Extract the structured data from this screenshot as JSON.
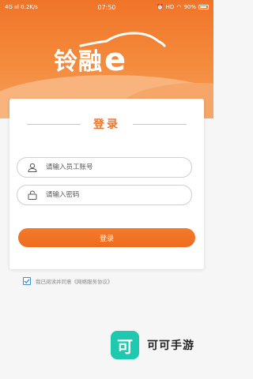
{
  "status_bar": {
    "left": "4G ııl 0.2K/s",
    "time": "07:50",
    "right_text": "HD",
    "battery": "90%"
  },
  "logo": {
    "text": "铃融",
    "e": "e"
  },
  "login": {
    "title": "登录",
    "username_placeholder": "请输入员工账号",
    "password_placeholder": "请输入密码",
    "button_label": "登录"
  },
  "agreement": {
    "text": "我已阅读并同意",
    "link": "《网络服务协议》",
    "checked": true
  },
  "watermark": {
    "glyph": "可",
    "text": "可可手游"
  },
  "colors": {
    "accent": "#f07428",
    "checkbox": "#3a8fd8",
    "watermark": "#1fc9b0"
  }
}
